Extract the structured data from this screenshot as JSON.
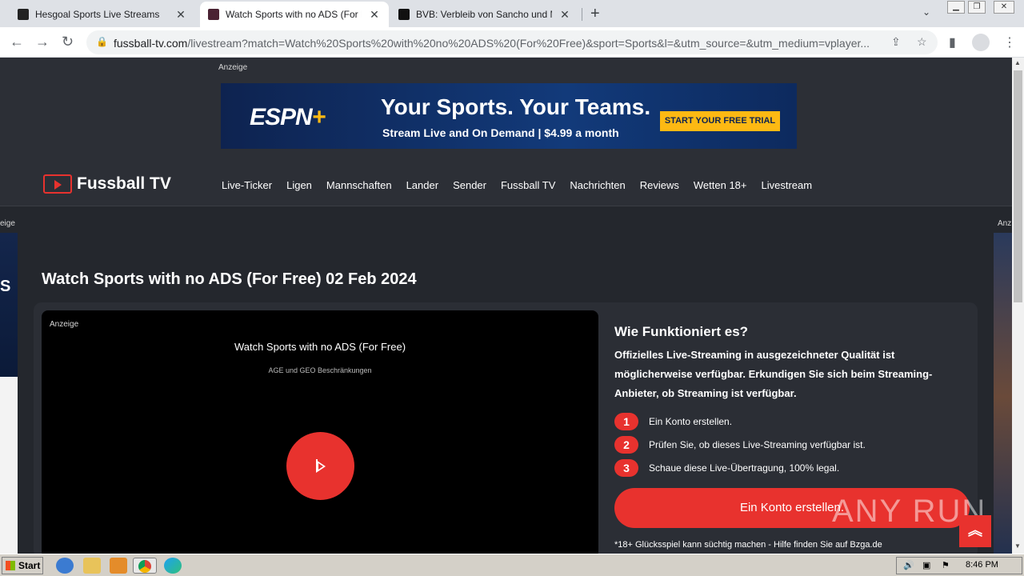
{
  "browser": {
    "tabs": [
      {
        "title": "Hesgoal Sports Live Streams",
        "favicon_color": "#222222",
        "active": false
      },
      {
        "title": "Watch Sports with no ADS (For Free",
        "favicon_color": "#4a2233",
        "active": true
      },
      {
        "title": "BVB: Verbleib von Sancho und Maats",
        "favicon_color": "#111111",
        "active": false
      }
    ],
    "new_tab_symbol": "+",
    "tab_menu_symbol": "⌄",
    "address": {
      "domain": "fussball-tv.com",
      "path": "/livestream?match=Watch%20Sports%20with%20no%20ADS%20(For%20Free)&sport=Sports&l=&utm_source=&utm_medium=vplayer..."
    }
  },
  "ads": {
    "label": "Anzeige",
    "espn": {
      "logo_text": "ESPN",
      "logo_plus": "+",
      "headline": "Your Sports. Your Teams.",
      "subline": "Stream Live and On Demand  |  $4.99 a month",
      "cta": "START YOUR FREE TRIAL"
    },
    "left_label": "eige",
    "left_letter": "S",
    "right_label": "Anz"
  },
  "site": {
    "logo_text": "Fussball TV",
    "nav": [
      "Live-Ticker",
      "Ligen",
      "Mannschaften",
      "Lander",
      "Sender",
      "Fussball TV",
      "Nachrichten",
      "Reviews",
      "Wetten 18+",
      "Livestream"
    ]
  },
  "main": {
    "title": "Watch Sports with no ADS (For Free) 02 Feb 2024",
    "player": {
      "ad_label": "Anzeige",
      "title": "Watch Sports with no ADS (For Free)",
      "subtitle": "AGE und GEO Beschränkungen"
    },
    "howto": {
      "title": "Wie Funktioniert es?",
      "description": "Offizielles Live-Streaming in ausgezeichneter Qualität ist möglicherweise verfügbar. Erkundigen Sie sich beim Streaming-Anbieter, ob Streaming ist verfügbar.",
      "steps": [
        {
          "num": "1",
          "text": "Ein Konto erstellen."
        },
        {
          "num": "2",
          "text": "Prüfen Sie, ob dieses Live-Streaming verfügbar ist."
        },
        {
          "num": "3",
          "text": "Schaue diese Live-Übertragung, 100% legal."
        }
      ],
      "button": "Ein Konto erstellen.",
      "disclaimer": "*18+ Glücksspiel kann süchtig machen - Hilfe finden Sie auf Bzga.de"
    },
    "watermark": "ANY RUN",
    "to_top": "︽"
  },
  "taskbar": {
    "start_label": "Start",
    "clock": "8:46 PM"
  },
  "colors": {
    "accent": "#e8322e",
    "page_bg": "#24272d",
    "espn_yellow": "#fdb913"
  }
}
